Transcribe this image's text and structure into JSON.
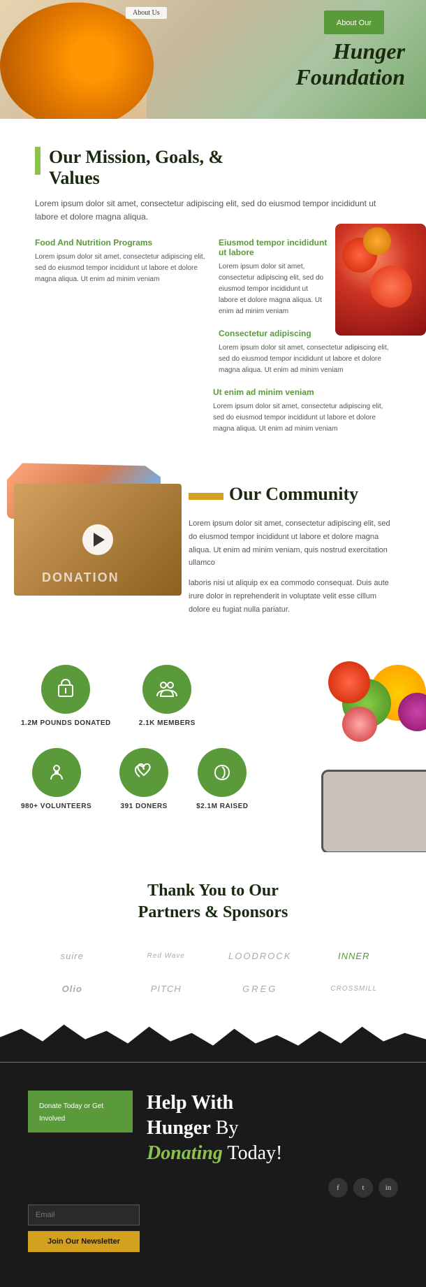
{
  "hero": {
    "breadcrumb": "About Us",
    "title_line1": "About Our",
    "title_line2": "Hunger",
    "title_line3": "Foundation"
  },
  "mission": {
    "section_title": "Our Mission, Goals, &\nValues",
    "description": "Lorem ipsum dolor sit amet, consectetur adipiscing elit, sed do eiusmod tempor incididunt ut labore et dolore magna aliqua.",
    "col1_title": "Food And Nutrition Programs",
    "col1_text": "Lorem ipsum dolor sit amet, consectetur adipiscing elit, sed do eiusmod tempor incididunt ut labore et dolore magna aliqua. Ut enim ad minim veniam",
    "col2_title": "Eiusmod tempor incididunt ut labore",
    "col2_text": "Lorem ipsum dolor sit amet, consectetur adipiscing elit, sed do eiusmod tempor incididunt ut labore et dolore magna aliqua. Ut enim ad minim veniam",
    "col3_title": "Consectetur adipiscing",
    "col3_text": "Lorem ipsum dolor sit amet, consectetur adipiscing elit, sed do eiusmod tempor incididunt ut labore et dolore magna aliqua. Ut enim ad minim veniam",
    "col4_title": "Ut enim ad minim veniam",
    "col4_text": "Lorem ipsum dolor sit amet, consectetur adipiscing elit, sed do eiusmod tempor incididunt ut labore et dolore magna aliqua. Ut enim ad minim veniam"
  },
  "community": {
    "title": "Our Community",
    "text1": "Lorem ipsum dolor sit amet, consectetur adipiscing elit, sed do eiusmod tempor incididunt ut labore et dolore magna aliqua. Ut enim ad minim veniam, quis nostrud exercitation ullamco",
    "text2": "laboris nisi ut aliquip ex ea commodo consequat. Duis aute irure dolor in reprehenderit in voluptate velit esse cillum dolore eu fugiat nulla pariatur.",
    "donation_label": "DONATION"
  },
  "stats": {
    "items": [
      {
        "value": "1.2M POUNDS DONATED",
        "icon": "package"
      },
      {
        "value": "2.1K MEMBERS",
        "icon": "people"
      },
      {
        "value": "980+ VOLUNTEERS",
        "icon": "hand"
      },
      {
        "value": "391 DONERS",
        "icon": "heart-hand"
      },
      {
        "value": "$2.1M RAISED",
        "icon": "heart"
      }
    ]
  },
  "sponsors": {
    "title": "Thank You to Our\nPartners & Sponsors",
    "logos": [
      "suire",
      "Red Wave",
      "LOODROCK",
      "INNER",
      "Olio",
      "PITCH",
      "GREG",
      "CROSSMILL"
    ]
  },
  "donate": {
    "green_box_label": "Donate Today or Get Involved",
    "title_part1": "Help With",
    "title_part2": "Hunger",
    "title_part3": " By",
    "title_part4": "Donating",
    "title_part5": " Today!",
    "email_placeholder": "Email",
    "button_label": "Join Our Newsletter",
    "social": [
      "f",
      "t",
      "in"
    ]
  }
}
